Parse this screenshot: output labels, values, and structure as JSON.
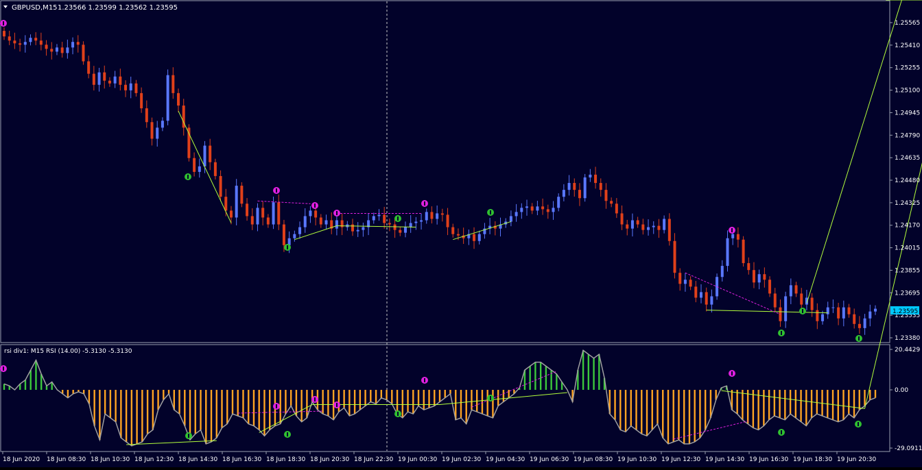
{
  "header": {
    "title": "GBPUSD,M15",
    "ohlc": "1.23566 1.23599 1.23562 1.23595"
  },
  "colors": {
    "background": "#02022a",
    "grid_border": "#9aa0b0",
    "up_candle": "#5a78ff",
    "down_candle": "#e0401a",
    "bearish_arrow": "#e020e0",
    "bullish_arrow": "#30c030",
    "rsi_pos": "#3cc83c",
    "rsi_neg": "#ffa423",
    "rsi_line": "#a0a0a0",
    "price_tag": "#00c8ff"
  },
  "price_axis": {
    "labels": [
      "1.25565",
      "1.25410",
      "1.25255",
      "1.25100",
      "1.24945",
      "1.24790",
      "1.24635",
      "1.24480",
      "1.24325",
      "1.24170",
      "1.24015",
      "1.23855",
      "1.23695",
      "1.23535",
      "1.23380"
    ],
    "current_price": "1.23595"
  },
  "indicator": {
    "title": "rsi div1: M15 RSI (14.00) -5.3130 -5.3130",
    "axis_labels": [
      "20.4429",
      "0.00",
      "-29.0911"
    ]
  },
  "time_axis": {
    "labels": [
      "18 Jun 2020",
      "18 Jun 08:30",
      "18 Jun 10:30",
      "18 Jun 12:30",
      "18 Jun 14:30",
      "18 Jun 16:30",
      "18 Jun 18:30",
      "18 Jun 20:30",
      "18 Jun 22:30",
      "19 Jun 00:30",
      "19 Jun 02:30",
      "19 Jun 04:30",
      "19 Jun 06:30",
      "19 Jun 08:30",
      "19 Jun 10:30",
      "19 Jun 12:30",
      "19 Jun 14:30",
      "19 Jun 16:30",
      "19 Jun 18:30",
      "19 Jun 20:30"
    ]
  },
  "chart_data": [
    {
      "type": "candlestick",
      "symbol": "GBPUSD",
      "timeframe": "M15",
      "ylim": [
        1.2338,
        1.2566
      ],
      "close_series": [
        1.2556,
        1.2553,
        1.2551,
        1.255,
        1.2552,
        1.2555,
        1.2553,
        1.255,
        1.2547,
        1.2545,
        1.2548,
        1.2544,
        1.2548,
        1.2552,
        1.255,
        1.2538,
        1.2529,
        1.2521,
        1.253,
        1.2524,
        1.2522,
        1.2527,
        1.2521,
        1.2517,
        1.2522,
        1.2515,
        1.2504,
        1.2494,
        1.2482,
        1.249,
        1.2495,
        1.2528,
        1.2515,
        1.2506,
        1.249,
        1.2468,
        1.2458,
        1.2462,
        1.2477,
        1.2465,
        1.2455,
        1.244,
        1.243,
        1.2425,
        1.2448,
        1.2435,
        1.2426,
        1.242,
        1.2432,
        1.2425,
        1.242,
        1.2436,
        1.242,
        1.2405,
        1.241,
        1.2413,
        1.2418,
        1.2426,
        1.243,
        1.2425,
        1.242,
        1.2423,
        1.2417,
        1.2423,
        1.2418,
        1.242,
        1.2415,
        1.2416,
        1.2418,
        1.2423,
        1.2426,
        1.2427,
        1.2421,
        1.242,
        1.2416,
        1.2414,
        1.2418,
        1.2421,
        1.2422,
        1.2423,
        1.2429,
        1.2424,
        1.2428,
        1.2427,
        1.2418,
        1.2413,
        1.2412,
        1.241,
        1.2413,
        1.2408,
        1.2413,
        1.2417,
        1.2419,
        1.2417,
        1.242,
        1.2422,
        1.2426,
        1.2429,
        1.2432,
        1.2433,
        1.243,
        1.2433,
        1.2431,
        1.2429,
        1.2432,
        1.244,
        1.2445,
        1.245,
        1.2445,
        1.2439,
        1.2454,
        1.2456,
        1.245,
        1.2445,
        1.2437,
        1.2435,
        1.2428,
        1.242,
        1.2417,
        1.2423,
        1.242,
        1.2416,
        1.2418,
        1.2419,
        1.2416,
        1.2424,
        1.2408,
        1.2385,
        1.2377,
        1.238,
        1.2375,
        1.2367,
        1.2371,
        1.2362,
        1.2368,
        1.2382,
        1.239,
        1.241,
        1.2413,
        1.2409,
        1.2392,
        1.2387,
        1.2378,
        1.2384,
        1.238,
        1.237,
        1.236,
        1.235,
        1.2368,
        1.2376,
        1.237,
        1.2362,
        1.2367,
        1.2358,
        1.235,
        1.2355,
        1.236,
        1.236,
        1.2352,
        1.236,
        1.2355,
        1.2348,
        1.2345,
        1.2352,
        1.2357,
        1.2359
      ]
    },
    {
      "type": "bar",
      "name": "RSI histogram",
      "ylim": [
        -29.0911,
        20.4429
      ],
      "values": [
        3,
        2,
        0,
        3,
        5,
        10,
        15,
        8,
        2,
        4,
        0,
        -2,
        -4,
        -2,
        -1,
        -2,
        -7,
        -18,
        -25,
        -12,
        -14,
        -16,
        -24,
        -26,
        -28,
        -27,
        -26,
        -22,
        -20,
        -10,
        -5,
        -2,
        -10,
        -12,
        -18,
        -25,
        -22,
        -20,
        -27,
        -26,
        -24,
        -19,
        -17,
        -12,
        -13,
        -14,
        -17,
        -18,
        -20,
        -23,
        -20,
        -18,
        -17,
        -12,
        -8,
        -13,
        -16,
        -14,
        -6,
        -10,
        -12,
        -13,
        -15,
        -11,
        -9,
        -13,
        -12,
        -10,
        -8,
        -6,
        -7,
        -4,
        -5,
        -7,
        -12,
        -14,
        -11,
        -12,
        -8,
        -10,
        -9,
        -8,
        -6,
        -4,
        -2,
        -15,
        -14,
        -17,
        -10,
        -11,
        -12,
        -13,
        -14,
        -8,
        -6,
        -4,
        -2,
        1,
        10,
        12,
        14,
        14,
        12,
        10,
        8,
        4,
        0,
        -6,
        10,
        20,
        18,
        16,
        18,
        6,
        -12,
        -15,
        -20,
        -21,
        -18,
        -20,
        -22,
        -23,
        -20,
        -17,
        -24,
        -27,
        -26,
        -25,
        -27,
        -27,
        -26,
        -24,
        -20,
        -14,
        -5,
        1,
        2,
        -10,
        -12,
        -15,
        -17,
        -19,
        -20,
        -18,
        -15,
        -13,
        -14,
        -15,
        -12,
        -14,
        -16,
        -18,
        -14,
        -12,
        -13,
        -14,
        -15,
        -16,
        -15,
        -12,
        -14,
        -10,
        -8,
        -5,
        -4
      ]
    }
  ]
}
